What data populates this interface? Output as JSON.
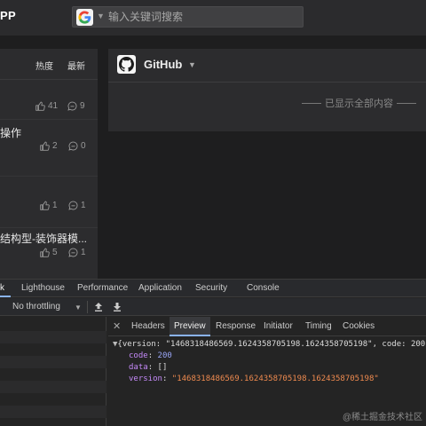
{
  "app": {
    "brand": "PP",
    "search": {
      "placeholder": "输入关键词搜索"
    }
  },
  "feed": {
    "sort": {
      "hot": "热度",
      "latest": "最新"
    },
    "articles": [
      {
        "title": "",
        "likes": "41",
        "comments": "9"
      },
      {
        "title": "操作",
        "likes": "2",
        "comments": "0"
      },
      {
        "title": "",
        "likes": "1",
        "comments": "1"
      },
      {
        "title": "结构型-装饰器模...",
        "likes": "5",
        "comments": "1"
      }
    ]
  },
  "github_panel": {
    "title": "GitHub",
    "end_text": "已显示全部内容"
  },
  "devtools": {
    "tabs": [
      "k",
      "Lighthouse",
      "Performance",
      "Application",
      "Security",
      "Console"
    ],
    "throttling": "No throttling",
    "detail_tabs": [
      "Headers",
      "Preview",
      "Response",
      "Initiator",
      "Timing",
      "Cookies"
    ],
    "active_detail_tab": "Preview",
    "preview": {
      "summary": "{version: \"1468318486569.1624358705198.1624358705198\", code: 200, da",
      "fields": [
        {
          "key": "code",
          "value": "200"
        },
        {
          "key": "data",
          "value": "[]"
        },
        {
          "key": "version",
          "value": "\"1468318486569.1624358705198.1624358705198\""
        }
      ]
    }
  },
  "watermark": "@稀土掘金技术社区",
  "colors": {
    "accent": "#8ab4f8",
    "json_key": "#c58af9",
    "json_string": "#ee8a4f",
    "json_number": "#9aa6f7"
  }
}
